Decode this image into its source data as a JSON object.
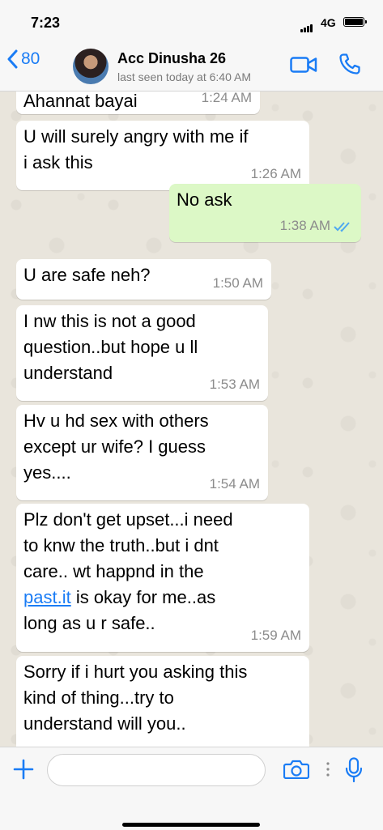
{
  "status_bar": {
    "time": "7:23",
    "network": "4G"
  },
  "header": {
    "back_count": "80",
    "contact_name": "Acc Dinusha 26",
    "last_seen": "last seen today at 6:40 AM"
  },
  "messages": [
    {
      "direction": "in",
      "text": "Ahannat bayai",
      "time": "1:24 AM"
    },
    {
      "direction": "in",
      "text": "U will surely angry with me if\ni ask this",
      "time": "1:26 AM"
    },
    {
      "direction": "out",
      "text": "No ask",
      "time": "1:38 AM",
      "status": "read"
    },
    {
      "direction": "in",
      "text": "U are safe neh?",
      "time": "1:50 AM"
    },
    {
      "direction": "in",
      "text": "I nw this is not a good\nquestion..but hope u ll\nunderstand",
      "time": "1:53 AM"
    },
    {
      "direction": "in",
      "text": "Hv u hd sex with others\nexcept ur wife? I guess\nyes....",
      "time": "1:54 AM"
    },
    {
      "direction": "in",
      "text_before": "Plz don't get upset...i need\nto knw the truth..but i dnt\ncare.. wt happnd in the\n",
      "link": "past.it",
      "text_after": " is okay for me..as\nlong as u r safe..",
      "time": "1:59 AM"
    },
    {
      "direction": "in",
      "text": "Sorry if i hurt you asking this\nkind of thing...try to\nunderstand will you..",
      "time": ""
    }
  ],
  "composer": {
    "placeholder": ""
  },
  "icons": {
    "back": "chevron-left-icon",
    "video": "video-camera-icon",
    "call": "phone-icon",
    "attach": "plus-icon",
    "camera": "camera-icon",
    "mic": "microphone-icon",
    "read_receipt": "double-check-icon"
  },
  "colors": {
    "accent": "#1a7cf5",
    "outgoing_bubble": "#dcf8c6",
    "incoming_bubble": "#ffffff",
    "read_tick": "#4fa8f0",
    "chat_background": "#e9e5dc"
  }
}
